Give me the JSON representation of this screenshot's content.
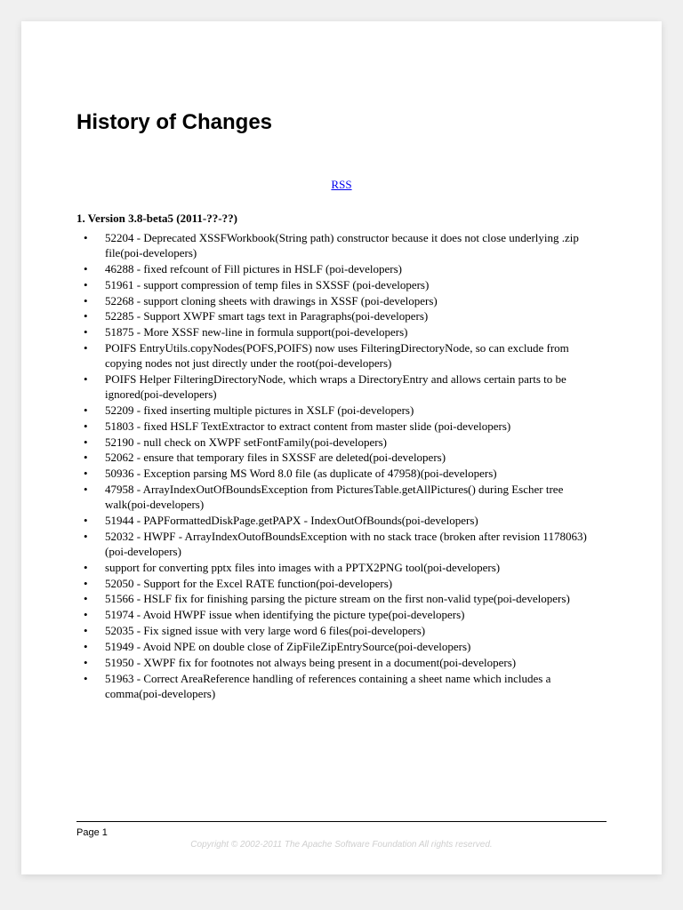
{
  "title": "History of Changes",
  "rss_label": "RSS",
  "section_heading": "1. Version 3.8-beta5 (2011-??-??)",
  "changes": [
    "52204 - Deprecated XSSFWorkbook(String path) constructor because it does not close underlying .zip file(poi-developers)",
    "46288 - fixed refcount of Fill pictures in HSLF (poi-developers)",
    "51961 - support compression of temp files in SXSSF (poi-developers)",
    "52268 - support cloning sheets with drawings in XSSF (poi-developers)",
    "52285 - Support XWPF smart tags text in Paragraphs(poi-developers)",
    "51875 - More XSSF new-line in formula support(poi-developers)",
    "POIFS EntryUtils.copyNodes(POFS,POIFS) now uses FilteringDirectoryNode, so can exclude from copying nodes not just directly under the root(poi-developers)",
    "POIFS Helper FilteringDirectoryNode, which wraps a DirectoryEntry and allows certain parts to be ignored(poi-developers)",
    "52209 - fixed inserting multiple pictures in XSLF (poi-developers)",
    "51803 - fixed HSLF TextExtractor to extract content from master slide (poi-developers)",
    "52190 - null check on XWPF setFontFamily(poi-developers)",
    "52062 - ensure that temporary files in SXSSF are deleted(poi-developers)",
    "50936 - Exception parsing MS Word 8.0 file (as duplicate of 47958)(poi-developers)",
    "47958 - ArrayIndexOutOfBoundsException from PicturesTable.getAllPictures() during Escher tree walk(poi-developers)",
    "51944 - PAPFormattedDiskPage.getPAPX - IndexOutOfBounds(poi-developers)",
    "52032 - HWPF - ArrayIndexOutofBoundsException with no stack trace (broken after revision 1178063)(poi-developers)",
    "support for converting pptx files into images with a PPTX2PNG tool(poi-developers)",
    "52050 - Support for the Excel RATE function(poi-developers)",
    "51566 - HSLF fix for finishing parsing the picture stream on the first non-valid type(poi-developers)",
    "51974 - Avoid HWPF issue when identifying the picture type(poi-developers)",
    "52035 - Fix signed issue with very large word 6 files(poi-developers)",
    "51949 - Avoid NPE on double close of ZipFileZipEntrySource(poi-developers)",
    "51950 - XWPF fix for footnotes not always being present in a document(poi-developers)",
    "51963 - Correct AreaReference handling of references containing a sheet name which includes a comma(poi-developers)"
  ],
  "page_label": "Page 1",
  "copyright": "Copyright © 2002-2011 The Apache Software Foundation All rights reserved."
}
